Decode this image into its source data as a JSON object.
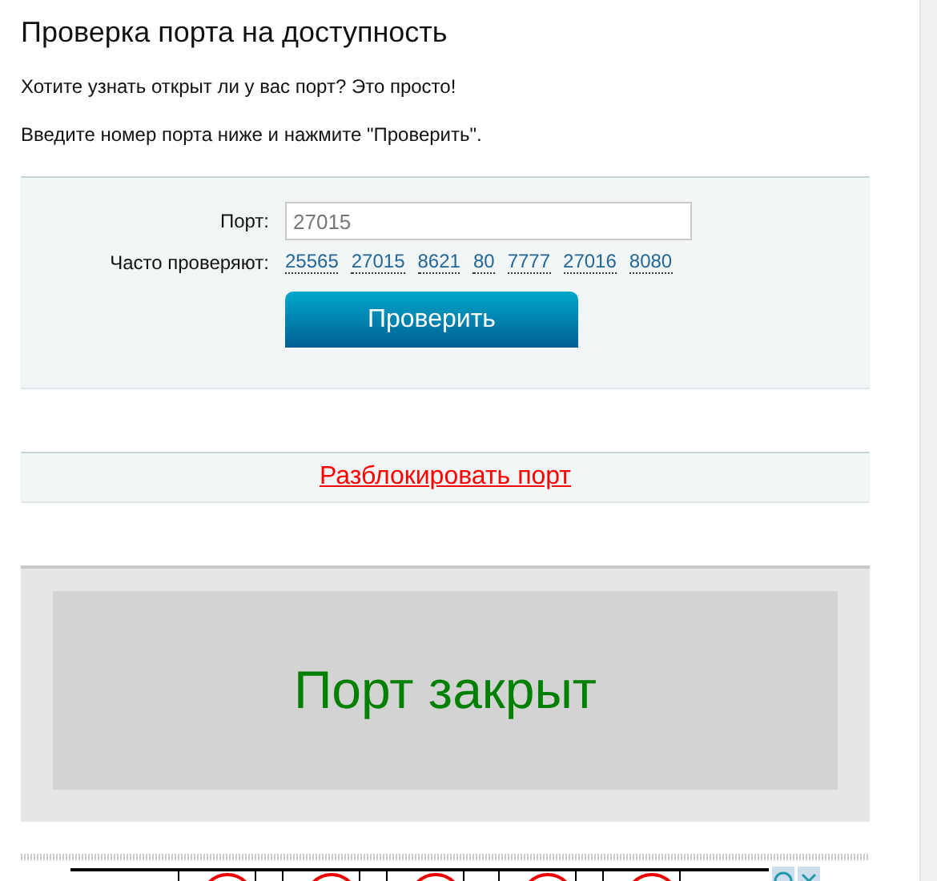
{
  "title": "Проверка порта на доступность",
  "intro": "Хотите узнать открыт ли у вас порт? Это просто!",
  "instruction": "Введите номер порта ниже и нажмите \"Проверить\".",
  "form": {
    "port_label": "Порт:",
    "port_value": "27015",
    "frequent_label": "Часто проверяют:",
    "frequent_ports": [
      "25565",
      "27015",
      "8621",
      "80",
      "7777",
      "27016",
      "8080"
    ],
    "submit": "Проверить"
  },
  "unblock_link": "Разблокировать порт",
  "result": {
    "text": "Порт закрыт",
    "open": false
  }
}
